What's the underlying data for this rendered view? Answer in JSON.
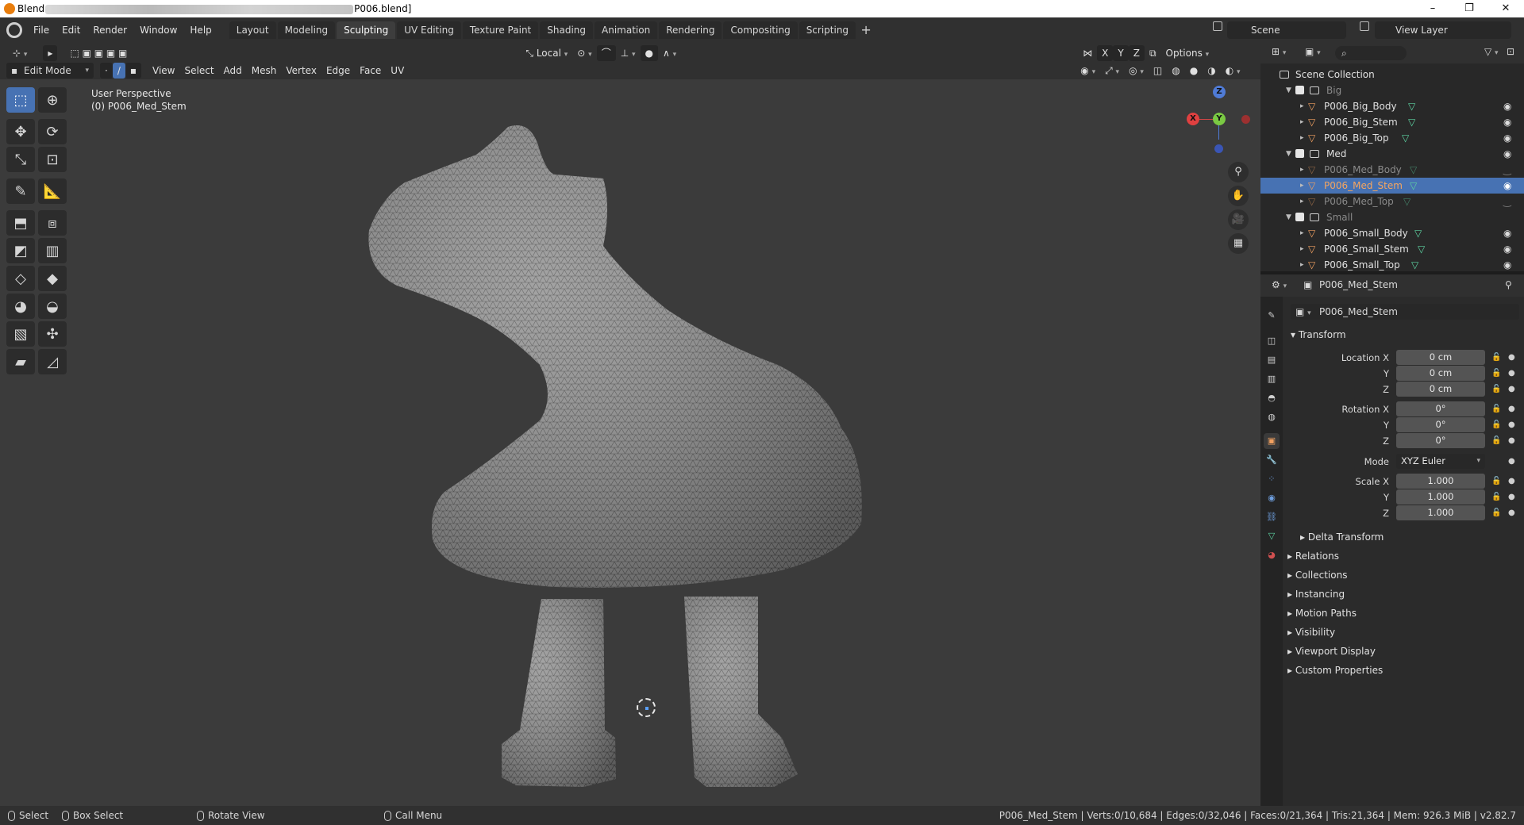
{
  "title_bar": {
    "app_prefix": "Blend",
    "file_suffix": "P006.blend]",
    "controls": [
      "–",
      "❐",
      "✕"
    ]
  },
  "menus": [
    "File",
    "Edit",
    "Render",
    "Window",
    "Help"
  ],
  "workspaces": [
    "Layout",
    "Modeling",
    "Sculpting",
    "UV Editing",
    "Texture Paint",
    "Shading",
    "Animation",
    "Rendering",
    "Compositing",
    "Scripting"
  ],
  "active_workspace": "Sculpting",
  "scene": "Scene",
  "view_layer": "View Layer",
  "viewport_header": {
    "transform_orientation": "Local",
    "axes": [
      "X",
      "Y",
      "Z"
    ],
    "options": "Options",
    "mode": "Edit Mode",
    "menus": [
      "View",
      "Select",
      "Add",
      "Mesh",
      "Vertex",
      "Edge",
      "Face",
      "UV"
    ]
  },
  "viewport": {
    "perspective_label": "User Perspective",
    "object_label": "(0) P006_Med_Stem",
    "gizmo": {
      "x": "X",
      "y": "Y",
      "z": "Z"
    }
  },
  "outliner": {
    "root": "Scene Collection",
    "collections": [
      {
        "name": "Big",
        "objects": [
          "P006_Big_Body",
          "P006_Big_Stem",
          "P006_Big_Top"
        ]
      },
      {
        "name": "Med",
        "objects": [
          "P006_Med_Body",
          "P006_Med_Stem",
          "P006_Med_Top"
        ]
      },
      {
        "name": "Small",
        "objects": [
          "P006_Small_Body",
          "P006_Small_Stem",
          "P006_Small_Top"
        ]
      }
    ],
    "selected": "P006_Med_Stem"
  },
  "properties": {
    "header_object": "P006_Med_Stem",
    "object_name": "P006_Med_Stem",
    "transform_title": "Transform",
    "location": {
      "label": "Location X",
      "x": "0 cm",
      "y": "0 cm",
      "z": "0 cm"
    },
    "rotation": {
      "label": "Rotation X",
      "x": "0°",
      "y": "0°",
      "z": "0°"
    },
    "mode_label": "Mode",
    "mode_value": "XYZ Euler",
    "scale": {
      "label": "Scale X",
      "x": "1.000",
      "y": "1.000",
      "z": "1.000"
    },
    "axis_y": "Y",
    "axis_z": "Z",
    "delta": "Delta Transform",
    "sections": [
      "Relations",
      "Collections",
      "Instancing",
      "Motion Paths",
      "Visibility",
      "Viewport Display",
      "Custom Properties"
    ]
  },
  "status_bar": {
    "select": "Select",
    "box_select": "Box Select",
    "rotate_view": "Rotate View",
    "call_menu": "Call Menu",
    "stats": "P006_Med_Stem | Verts:0/10,684 | Edges:0/32,046 | Faces:0/21,364 | Tris:21,364 | Mem: 926.3 MiB | v2.82.7"
  },
  "colors": {
    "accent": "#4772b3",
    "selected_text": "#f4a560",
    "mesh_fill": "#8c8c8c",
    "viewport_bg": "#3b3b3b"
  }
}
